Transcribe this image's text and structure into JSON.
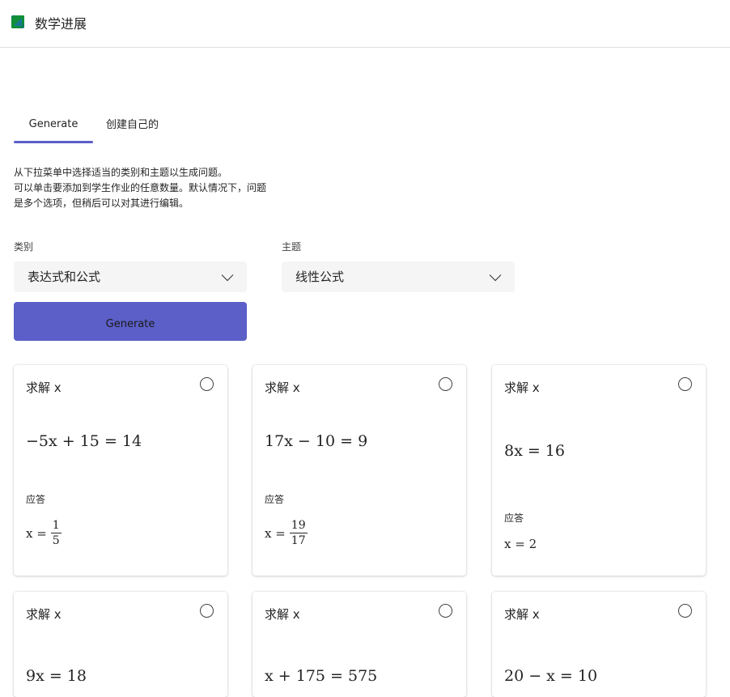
{
  "header": {
    "app_title": "数学进展"
  },
  "tabs": {
    "generate": "Generate",
    "own": "创建自己的"
  },
  "instructions": [
    "从下拉菜单中选择适当的类别和主题以生成问题。",
    "可以单击要添加到学生作业的任意数量。默认情况下，问题",
    "是多个选项，但稍后可以对其进行编辑。"
  ],
  "form": {
    "category_label": "类别",
    "category_value": "表达式和公式",
    "topic_label": "主题",
    "topic_value": "线性公式",
    "generate_label": "Generate"
  },
  "cards": [
    {
      "prompt": "求解 x",
      "equation": "−5x + 15 = 14",
      "answer_label": "应答",
      "answer_lhs": "x =",
      "answer_num": "1",
      "answer_den": "5"
    },
    {
      "prompt": "求解 x",
      "equation": "17x − 10 = 9",
      "answer_label": "应答",
      "answer_lhs": "x =",
      "answer_num": "19",
      "answer_den": "17"
    },
    {
      "prompt": "求解 x",
      "equation": "8x = 16",
      "answer_label": "应答",
      "answer_text": "x = 2"
    },
    {
      "prompt": "求解 x",
      "equation": "9x = 18"
    },
    {
      "prompt": "求解 x",
      "equation": "x + 175 = 575"
    },
    {
      "prompt": "求解 x",
      "equation": "20 − x = 10"
    }
  ],
  "colors": {
    "accent": "#5b5fc7",
    "dropdown_bg": "#f5f5f5",
    "divider": "#e0e0e0"
  }
}
